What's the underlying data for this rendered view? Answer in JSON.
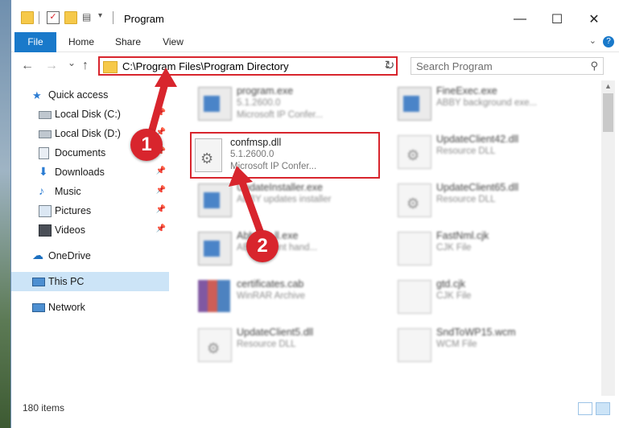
{
  "window": {
    "title": "Program"
  },
  "window_controls": {
    "minimize": "—",
    "maximize": "☐",
    "close": "✕"
  },
  "ribbon": {
    "tabs": [
      "File",
      "Home",
      "Share",
      "View"
    ],
    "help": "?"
  },
  "nav": {
    "back": "←",
    "forward": "→",
    "recent": "⌄",
    "up": "↑",
    "address": "C:\\Program Files\\Program Directory",
    "refresh": "↻",
    "search_placeholder": "Search Program"
  },
  "sidebar": {
    "items": [
      {
        "label": "Quick access",
        "icon": "star-icon"
      },
      {
        "label": "Local Disk (C:)",
        "icon": "drive-icon",
        "pinned": true
      },
      {
        "label": "Local Disk (D:)",
        "icon": "drive-icon",
        "pinned": true
      },
      {
        "label": "Documents",
        "icon": "documents-icon",
        "pinned": true
      },
      {
        "label": "Downloads",
        "icon": "download-icon",
        "pinned": true
      },
      {
        "label": "Music",
        "icon": "music-icon",
        "pinned": true
      },
      {
        "label": "Pictures",
        "icon": "pictures-icon",
        "pinned": true
      },
      {
        "label": "Videos",
        "icon": "videos-icon",
        "pinned": true
      },
      {
        "label": "OneDrive",
        "icon": "cloud-icon"
      },
      {
        "label": "This PC",
        "icon": "computer-icon",
        "selected": true
      },
      {
        "label": "Network",
        "icon": "network-icon"
      }
    ]
  },
  "files": [
    {
      "name": "program.exe",
      "line2": "5.1.2600.0",
      "line3": "Microsoft IP Confer...",
      "type": "exe"
    },
    {
      "name": "FineExec.exe",
      "line2": "ABBY background exe...",
      "line3": "",
      "type": "exe"
    },
    {
      "name": "confmsp.dll",
      "line2": "5.1.2600.0",
      "line3": "Microsoft IP Confer...",
      "type": "dll"
    },
    {
      "name": "UpdateClient42.dll",
      "line2": "Resource DLL",
      "line3": "",
      "type": "dll"
    },
    {
      "name": "UpdateInstaller.exe",
      "line2": "ABBY updates installer",
      "line3": "",
      "type": "exe"
    },
    {
      "name": "UpdateClient65.dll",
      "line2": "Resource DLL",
      "line3": "",
      "type": "dll"
    },
    {
      "name": "AbbyE...ll.exe",
      "line2": "ABBY event hand...",
      "line3": "",
      "type": "exe"
    },
    {
      "name": "FastNml.cjk",
      "line2": "CJK File",
      "line3": "",
      "type": "doc"
    },
    {
      "name": "certificates.cab",
      "line2": "WinRAR Archive",
      "line3": "",
      "type": "cab"
    },
    {
      "name": "gtd.cjk",
      "line2": "CJK File",
      "line3": "",
      "type": "doc"
    },
    {
      "name": "UpdateClient5.dll",
      "line2": "Resource DLL",
      "line3": "",
      "type": "dll"
    },
    {
      "name": "SndToWP15.wcm",
      "line2": "WCM File",
      "line3": "",
      "type": "doc"
    }
  ],
  "status": {
    "item_count": "180 items"
  },
  "annotations": {
    "step1": "1",
    "step2": "2",
    "color": "#d8252d"
  }
}
